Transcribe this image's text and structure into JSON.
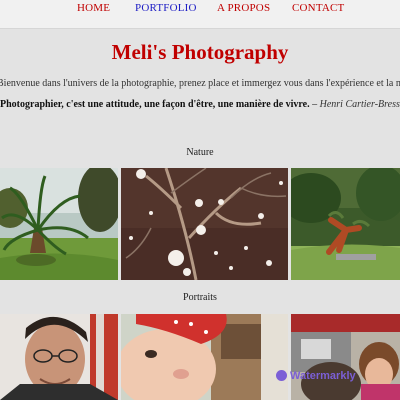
{
  "nav": {
    "items": [
      {
        "label": "HOME",
        "active": false
      },
      {
        "label": "PORTFOLIO",
        "active": true
      },
      {
        "label": "A PROPOS",
        "active": false
      },
      {
        "label": "CONTACT",
        "active": false
      }
    ]
  },
  "header": {
    "title": "Meli's Photography"
  },
  "intro": {
    "text": "Bienvenue dans l'univers de la photographie, prenez place et immergez vous dans l'expérience et la nature."
  },
  "quote": {
    "text": "Photographier, c'est une attitude, une façon d'être, une manière de vivre.",
    "dash": " – ",
    "author": "Henri Cartier-Bresson"
  },
  "sections": [
    {
      "title": "Nature",
      "photos": [
        "palm-tree",
        "snowy-branches",
        "wooden-figure"
      ]
    },
    {
      "title": "Portraits",
      "photos": [
        "man-with-glasses",
        "baby-red-hat",
        "children-in-car"
      ]
    }
  ],
  "watermark": {
    "text": "Watermarkly",
    "icon": "watermark-icon"
  },
  "colors": {
    "brand": "#c00000",
    "nav_active": "#1c1cc4",
    "background": "#e3e3e3"
  }
}
